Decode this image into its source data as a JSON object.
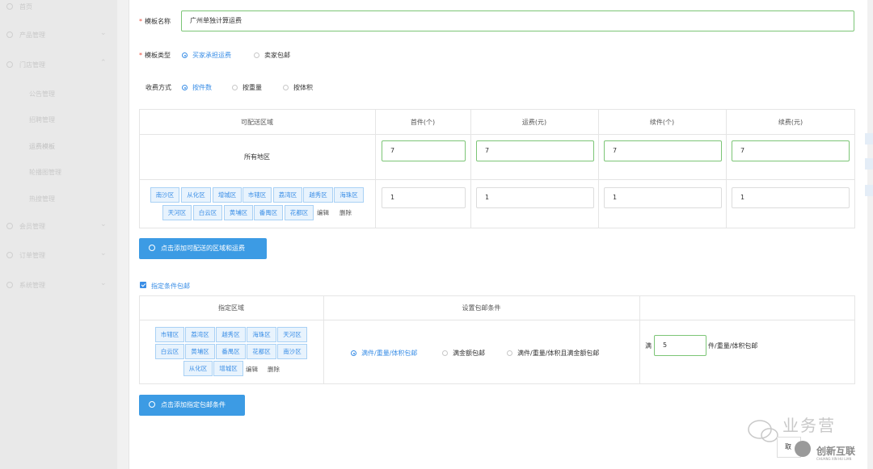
{
  "sidebar": {
    "items": [
      {
        "label": "首页",
        "icon": "home-icon"
      },
      {
        "label": "产品管理",
        "icon": "user-icon"
      },
      {
        "label": "门店管理",
        "icon": "store-icon"
      },
      {
        "label": "会员管理",
        "icon": "member-icon"
      },
      {
        "label": "订单管理",
        "icon": "order-icon"
      },
      {
        "label": "系统管理",
        "icon": "settings-icon"
      }
    ],
    "sub_items": [
      "公告管理",
      "招聘管理",
      "运费模板",
      "轮播图管理",
      "热搜管理"
    ]
  },
  "form": {
    "name_label": "模板名称",
    "name_value": "广州单独计算运费",
    "type_label": "模板类型",
    "type_options": [
      "买家承担运费",
      "卖家包邮"
    ],
    "type_selected": "买家承担运费",
    "charge_label": "收费方式",
    "charge_options": [
      "按件数",
      "按重量",
      "按体积"
    ],
    "charge_selected": "按件数"
  },
  "shipping_table": {
    "headers": [
      "可配送区域",
      "首件(个)",
      "运费(元)",
      "续件(个)",
      "续费(元)"
    ],
    "row1": {
      "area": "所有地区",
      "values": [
        "7",
        "7",
        "7",
        "7"
      ]
    },
    "row2": {
      "tags": [
        "南沙区",
        "从化区",
        "增城区",
        "市辖区",
        "荔湾区",
        "越秀区",
        "海珠区",
        "天河区",
        "白云区",
        "黄埔区",
        "番禺区",
        "花都区"
      ],
      "edit": "编辑",
      "delete": "删除",
      "values": [
        "1",
        "1",
        "1",
        "1"
      ]
    }
  },
  "add_area_button": "点击添加可配送的区域和运费",
  "free_shipping": {
    "checkbox_label": "指定条件包邮",
    "checked": true,
    "headers": [
      "指定区域",
      "设置包邮条件"
    ],
    "tags": [
      "市辖区",
      "荔湾区",
      "越秀区",
      "海珠区",
      "天河区",
      "白云区",
      "黄埔区",
      "番禺区",
      "花都区",
      "南沙区",
      "从化区",
      "增城区"
    ],
    "edit": "编辑",
    "delete": "删除",
    "condition_options": [
      "满件/重量/体积包邮",
      "满金额包邮",
      "满件/重量/体积且满金额包邮"
    ],
    "condition_selected": "满件/重量/体积包邮",
    "prefix": "满",
    "amount": "5",
    "suffix": "件/重量/体积包邮"
  },
  "add_condition_button": "点击添加指定包邮条件",
  "watermark": {
    "cancel": "取",
    "text": "业务营",
    "brand": "创新互联",
    "sub": "CHUANG XIN HU LIAN"
  },
  "colors": {
    "accent": "#3a8ee6",
    "button": "#3c9be4",
    "valid_border": "#7cc576",
    "tag_bg": "#e8f3fd"
  }
}
